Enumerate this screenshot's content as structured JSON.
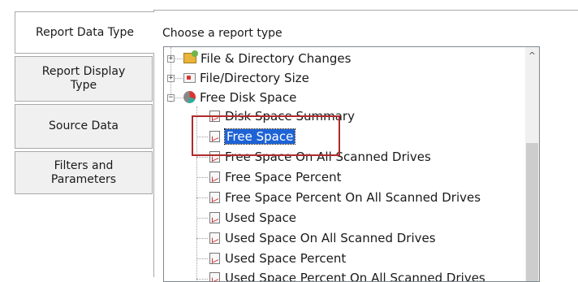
{
  "tabs": [
    {
      "label": "Report Data Type",
      "active": true
    },
    {
      "label": "Report Display\nType",
      "active": false
    },
    {
      "label": "Source Data",
      "active": false
    },
    {
      "label": "Filters and\nParameters",
      "active": false
    }
  ],
  "panel": {
    "label": "Choose a report type"
  },
  "tree": {
    "groups": [
      {
        "label": "File & Directory Changes",
        "icon": "folder-changes-icon",
        "expanded": false
      },
      {
        "label": "File/Directory Size",
        "icon": "file-size-icon",
        "expanded": false
      },
      {
        "label": "Free Disk Space",
        "icon": "disk-pie-icon",
        "expanded": true
      }
    ],
    "children": [
      {
        "label": "Disk Space Summary",
        "selected": false
      },
      {
        "label": "Free Space",
        "selected": true
      },
      {
        "label": "Free Space On All Scanned Drives",
        "selected": false
      },
      {
        "label": "Free Space Percent",
        "selected": false
      },
      {
        "label": "Free Space Percent On All Scanned Drives",
        "selected": false
      },
      {
        "label": "Used Space",
        "selected": false
      },
      {
        "label": "Used Space On All Scanned Drives",
        "selected": false
      },
      {
        "label": "Used Space Percent",
        "selected": false
      },
      {
        "label": "Used Space Percent On All Scanned Drives",
        "selected": false
      }
    ]
  },
  "colors": {
    "selection": "#1e63d6",
    "highlight_box": "#b02a2a"
  }
}
